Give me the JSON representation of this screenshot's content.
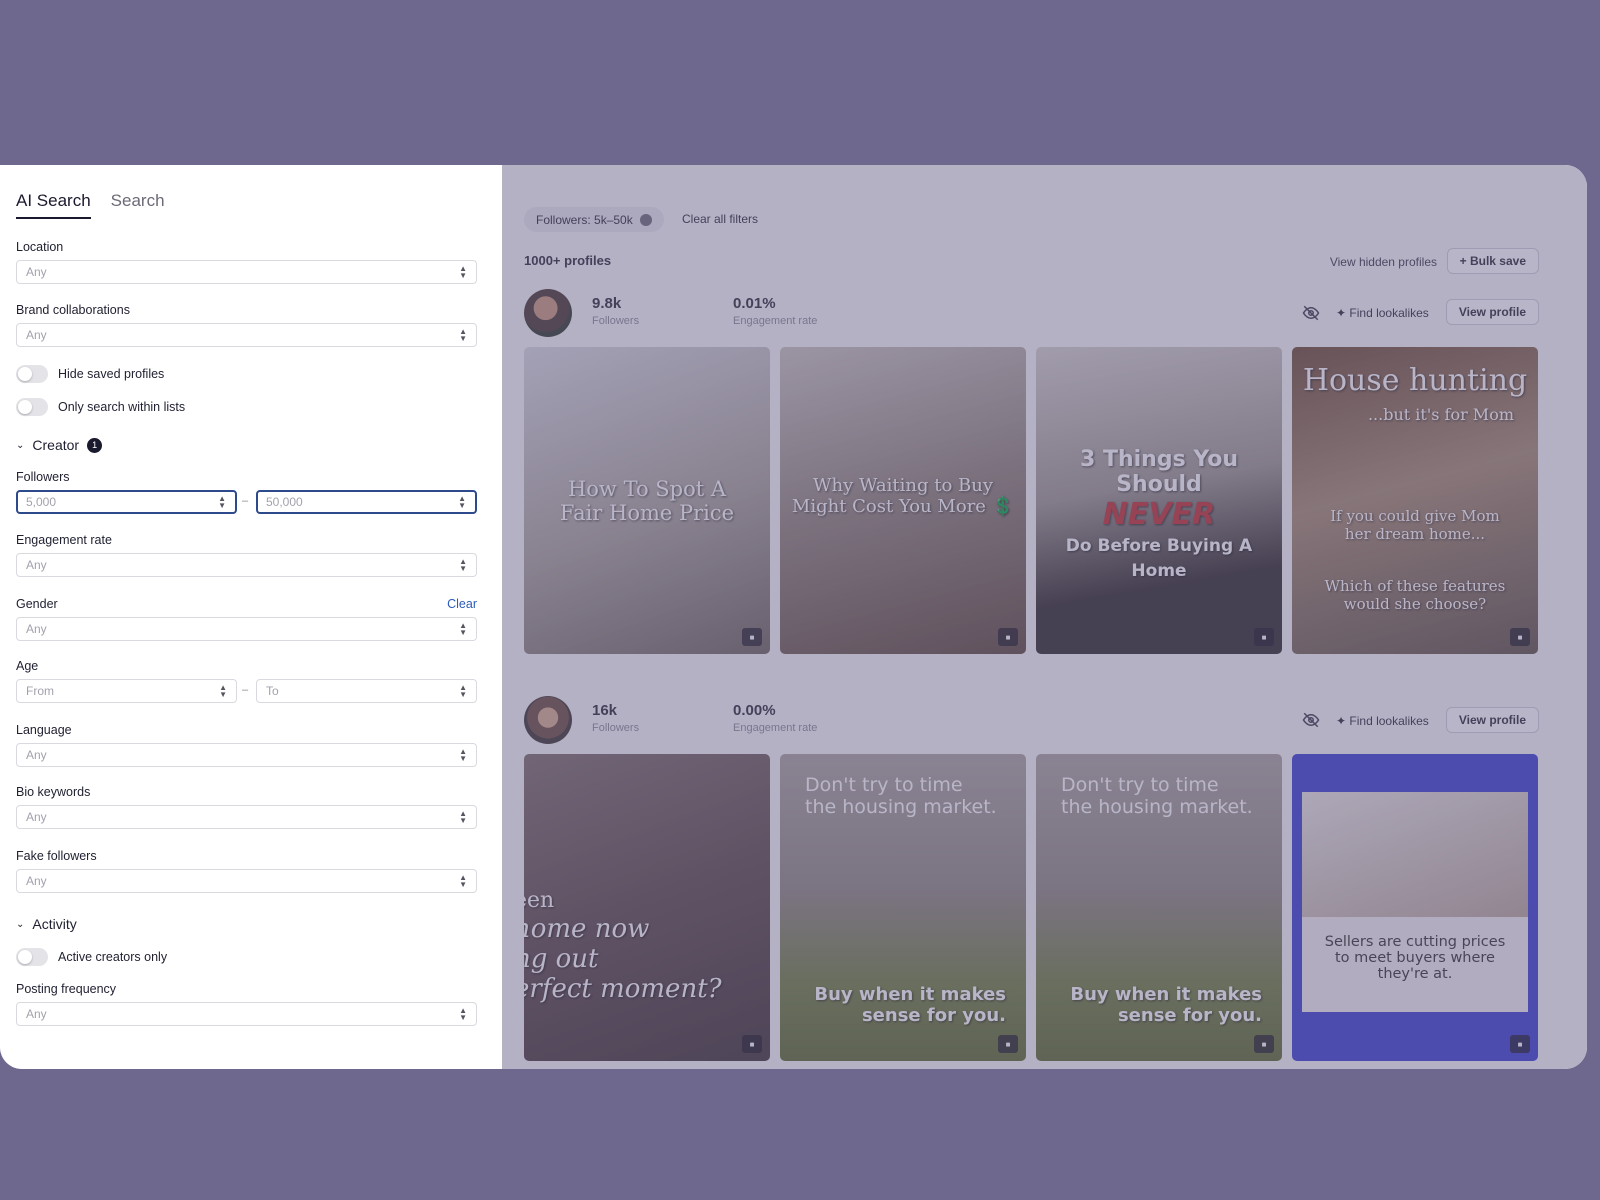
{
  "sidebar": {
    "tabs": [
      "AI Search",
      "Search"
    ],
    "location": {
      "label": "Location",
      "value": "Any"
    },
    "brand": {
      "label": "Brand collaborations",
      "value": "Any"
    },
    "hide_saved": "Hide saved profiles",
    "only_lists": "Only search within lists",
    "creator": {
      "title": "Creator",
      "badge": "1"
    },
    "followers": {
      "label": "Followers",
      "min": "5,000",
      "max": "50,000",
      "dash": "–"
    },
    "engagement": {
      "label": "Engagement rate",
      "value": "Any"
    },
    "gender": {
      "label": "Gender",
      "value": "Any",
      "clear": "Clear"
    },
    "age": {
      "label": "Age",
      "from": "From",
      "to": "To",
      "dash": "–"
    },
    "language": {
      "label": "Language",
      "value": "Any"
    },
    "bio": {
      "label": "Bio keywords",
      "value": "Any"
    },
    "fake": {
      "label": "Fake followers",
      "value": "Any"
    },
    "activity": {
      "title": "Activity"
    },
    "active_only": "Active creators only",
    "posting": {
      "label": "Posting frequency",
      "value": "Any"
    }
  },
  "main": {
    "filter_chip": "Followers: 5k–50k",
    "clear_all": "Clear all filters",
    "count": "1000+ profiles",
    "view_hidden": "View hidden profiles",
    "bulk_save": "+ Bulk save",
    "profiles": [
      {
        "followers": "9.8k",
        "followers_label": "Followers",
        "engagement": "0.01%",
        "engagement_label": "Engagement rate",
        "find": "Find lookalikes",
        "view": "View profile",
        "posts": [
          {
            "l1": "How To Spot A",
            "l2": "Fair Home Price"
          },
          {
            "l1": "Why Waiting to Buy",
            "l2": "Might Cost You More 💲"
          },
          {
            "l1": "3 Things You Should",
            "l2": "NEVER",
            "l3": "Do Before Buying A Home"
          },
          {
            "l1": "House hunting",
            "l2": "...but it's for Mom",
            "l3": "If you could give Mom",
            "l4": "her dream home...",
            "l5": "Which of these features",
            "l6": "would she choose?"
          }
        ]
      },
      {
        "followers": "16k",
        "followers_label": "Followers",
        "engagement": "0.00%",
        "engagement_label": "Engagement rate",
        "find": "Find lookalikes",
        "view": "View profile",
        "posts": [
          {
            "l1": "een",
            "l2": "home now",
            "l3": "ng out",
            "l4": "erfect moment?"
          },
          {
            "l1": "Don't try to time",
            "l2": "the housing market.",
            "l3": "Buy when it makes",
            "l4": "sense for you."
          },
          {
            "l1": "Don't try to time",
            "l2": "the housing market.",
            "l3": "Buy when it makes",
            "l4": "sense for you."
          },
          {
            "l1": "Sellers are cutting prices",
            "l2": "to meet buyers where",
            "l3": "they're at."
          }
        ]
      }
    ]
  },
  "icons": {
    "video": "video-icon",
    "hide": "eye-off-icon",
    "sparkle": "sparkle-icon"
  }
}
